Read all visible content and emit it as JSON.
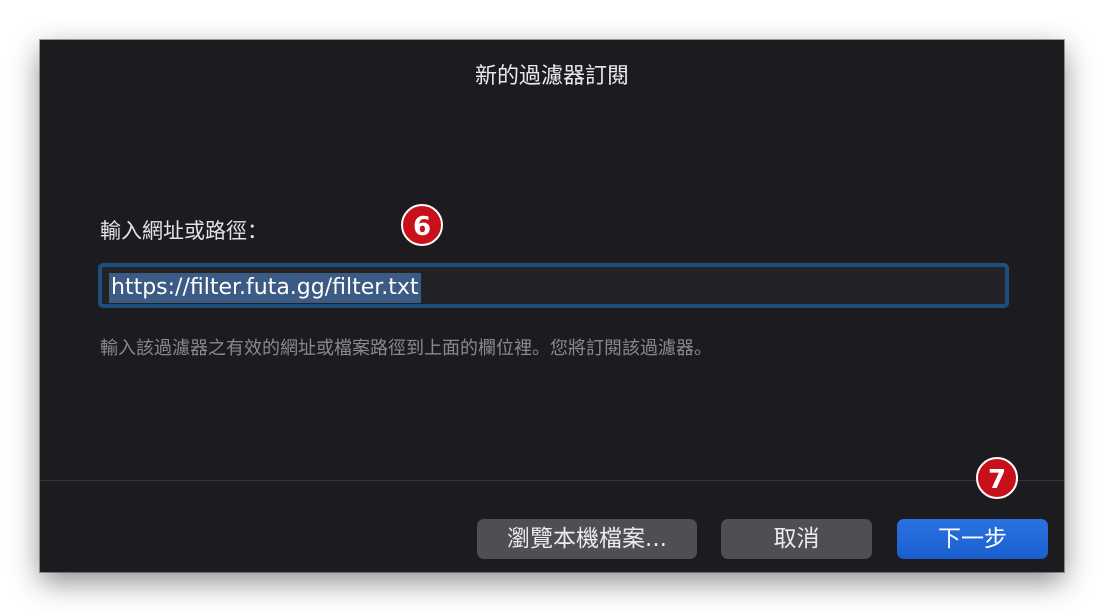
{
  "dialog": {
    "title": "新的過濾器訂閱",
    "prompt_label": "輸入網址或路徑：",
    "url_field": {
      "value": "https://filter.futa.gg/filter.txt",
      "selected": true
    },
    "hint": "輸入該過濾器之有效的網址或檔案路徑到上面的欄位裡。您將訂閱該過濾器。",
    "buttons": {
      "browse_label": "瀏覽本機檔案...",
      "cancel_label": "取消",
      "next_label": "下一步"
    }
  },
  "annotations": {
    "step_6": "6",
    "step_7": "7"
  },
  "colors": {
    "dialog_background": "#1c1c20",
    "focus_ring": "#1e4e7e",
    "selection": "#3b5a84",
    "primary_button": "#1b5fcf",
    "secondary_button": "#4e4e54",
    "step_marker": "#c8101a"
  }
}
